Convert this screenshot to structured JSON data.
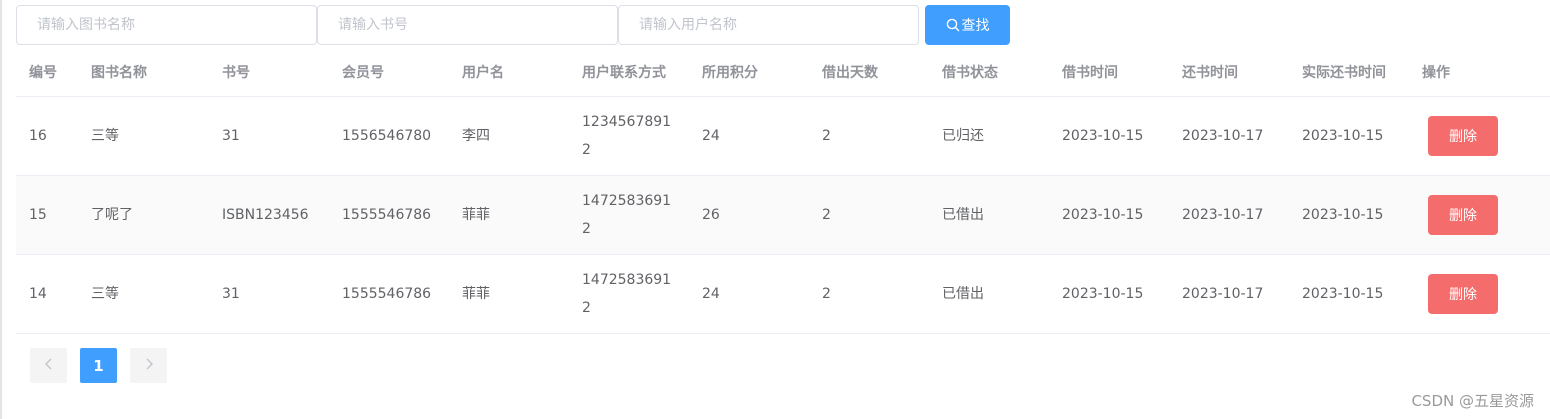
{
  "search": {
    "book_name_placeholder": "请输入图书名称",
    "isbn_placeholder": "请输入书号",
    "user_name_placeholder": "请输入用户名称",
    "button_label": "查找"
  },
  "table": {
    "headers": [
      "编号",
      "图书名称",
      "书号",
      "会员号",
      "用户名",
      "用户联系方式",
      "所用积分",
      "借出天数",
      "借书状态",
      "借书时间",
      "还书时间",
      "实际还书时间",
      "操作"
    ],
    "rows": [
      {
        "id": "16",
        "book_name": "三等",
        "isbn": "31",
        "member_no": "1556546780",
        "username": "李四",
        "contact": "12345678912",
        "points": "24",
        "days": "2",
        "status": "已归还",
        "borrow_time": "2023-10-15",
        "return_time": "2023-10-17",
        "actual_return_time": "2023-10-15",
        "action": "删除"
      },
      {
        "id": "15",
        "book_name": "了呢了",
        "isbn": "ISBN123456",
        "member_no": "1555546786",
        "username": "菲菲",
        "contact": "14725836912",
        "points": "26",
        "days": "2",
        "status": "已借出",
        "borrow_time": "2023-10-15",
        "return_time": "2023-10-17",
        "actual_return_time": "2023-10-15",
        "action": "删除"
      },
      {
        "id": "14",
        "book_name": "三等",
        "isbn": "31",
        "member_no": "1555546786",
        "username": "菲菲",
        "contact": "14725836912",
        "points": "24",
        "days": "2",
        "status": "已借出",
        "borrow_time": "2023-10-15",
        "return_time": "2023-10-17",
        "actual_return_time": "2023-10-15",
        "action": "删除"
      }
    ]
  },
  "pagination": {
    "prev_icon": "chevron-left-icon",
    "current_page": "1",
    "next_icon": "chevron-right-icon"
  },
  "watermark": "CSDN @五星资源",
  "colors": {
    "primary": "#409eff",
    "danger": "#f56c6c"
  }
}
